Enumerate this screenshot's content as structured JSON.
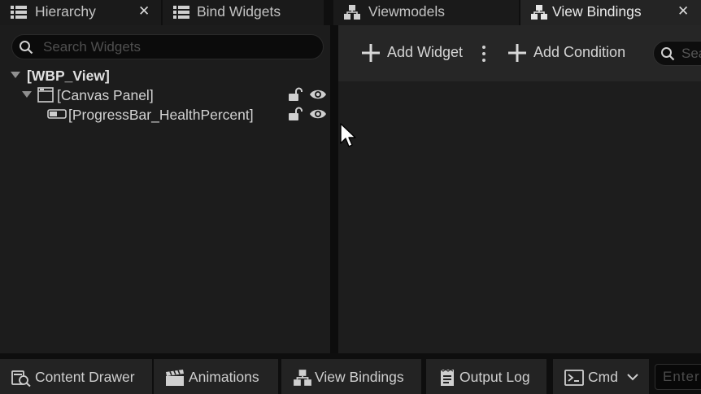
{
  "tabs": [
    {
      "label": "Hierarchy",
      "icon": "list-icon",
      "closable": true,
      "active": false
    },
    {
      "label": "Bind Widgets",
      "icon": "list-icon",
      "closable": false,
      "active": false
    },
    {
      "label": "Viewmodels",
      "icon": "hierarchy-icon",
      "closable": false,
      "active": false
    },
    {
      "label": "View Bindings",
      "icon": "hierarchy-icon",
      "closable": true,
      "active": true
    }
  ],
  "close_glyph": "✕",
  "hierarchy": {
    "search_placeholder": "Search Widgets",
    "tree": [
      {
        "label": "[WBP_View]",
        "icon": "expand-triangle-icon"
      },
      {
        "label": "[Canvas Panel]",
        "icon": "canvas-panel-icon"
      },
      {
        "label": "[ProgressBar_HealthPercent]",
        "icon": "progress-bar-icon"
      }
    ]
  },
  "view_bindings": {
    "add_widget_label": "Add Widget",
    "add_condition_label": "Add Condition",
    "search_placeholder": "Search"
  },
  "bottombar": {
    "content_drawer": "Content Drawer",
    "animations": "Animations",
    "view_bindings": "View Bindings",
    "output_log": "Output Log",
    "cmd": "Cmd",
    "cmd_placeholder": "Enter Console Command"
  },
  "colors": {
    "background": "#151515",
    "active_tab": "#242424",
    "panel": "#1c1c1c",
    "text": "#d2d2d2",
    "icon": "#d0d0d0"
  }
}
